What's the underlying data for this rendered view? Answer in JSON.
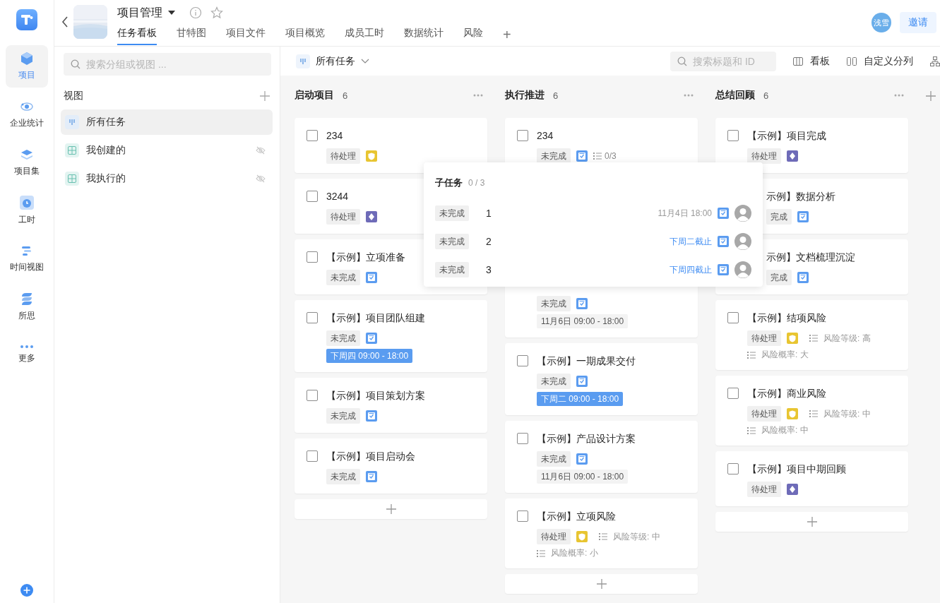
{
  "rail": {
    "items": [
      {
        "label": "项目",
        "selected": true
      },
      {
        "label": "企业统计",
        "selected": false
      },
      {
        "label": "项目集",
        "selected": false
      },
      {
        "label": "工时",
        "selected": false
      },
      {
        "label": "时间视图",
        "selected": false
      },
      {
        "label": "所思",
        "selected": false
      },
      {
        "label": "更多",
        "selected": false
      }
    ]
  },
  "header": {
    "title": "项目管理",
    "tabs": [
      {
        "label": "任务看板",
        "selected": true
      },
      {
        "label": "甘特图",
        "selected": false
      },
      {
        "label": "项目文件",
        "selected": false
      },
      {
        "label": "项目概览",
        "selected": false
      },
      {
        "label": "成员工时",
        "selected": false
      },
      {
        "label": "数据统计",
        "selected": false
      },
      {
        "label": "风险",
        "selected": false
      }
    ],
    "add_tab": "+",
    "avatar": "浅雪",
    "invite": "邀请"
  },
  "sidebar": {
    "search": {
      "placeholder": "搜索分组或视图 ..."
    },
    "section": "视图",
    "views": [
      {
        "label": "所有任务",
        "kind": "board",
        "selected": true,
        "hidden": false
      },
      {
        "label": "我创建的",
        "kind": "table",
        "selected": false,
        "hidden": true
      },
      {
        "label": "我执行的",
        "kind": "table",
        "selected": false,
        "hidden": true
      }
    ]
  },
  "toolbar": {
    "view": "所有任务",
    "search": {
      "placeholder": "搜索标题和 ID"
    },
    "actions": [
      "看板",
      "自定义分列"
    ]
  },
  "columns": [
    {
      "title": "启动项目",
      "count": "6",
      "cards": [
        {
          "kind": "normal",
          "title": "234",
          "checked": false,
          "status": "待处理",
          "badge": {
            "kind": "risk"
          }
        },
        {
          "kind": "normal",
          "title": "3244",
          "checked": false,
          "status": "待处理",
          "badge": {
            "kind": "milestone"
          }
        },
        {
          "kind": "normal",
          "title": "【示例】立项准备",
          "checked": false,
          "status": "未完成",
          "badge": {
            "kind": "task"
          }
        },
        {
          "kind": "normal",
          "title": "【示例】项目团队组建",
          "checked": false,
          "status": "未完成",
          "badge": {
            "kind": "task"
          },
          "date": {
            "text": "下周四 09:00 - 18:00",
            "highlight": true
          }
        },
        {
          "kind": "normal",
          "title": "【示例】项目策划方案",
          "checked": false,
          "status": "未完成",
          "badge": {
            "kind": "task"
          }
        },
        {
          "kind": "normal",
          "title": "【示例】项目启动会",
          "checked": false,
          "status": "未完成",
          "badge": {
            "kind": "task"
          }
        }
      ]
    },
    {
      "title": "执行推进",
      "count": "6",
      "cards": [
        {
          "kind": "normal",
          "title": "234",
          "checked": false,
          "status": "未完成",
          "badge": {
            "kind": "task"
          },
          "subtasks": "0/3"
        },
        {
          "kind": "untitled",
          "status": "未完成",
          "badge": {
            "kind": "task"
          },
          "date": {
            "text": "11月6日 09:00 - 18:00",
            "highlight": false
          }
        },
        {
          "kind": "normal",
          "title": "【示例】一期成果交付",
          "checked": false,
          "status": "未完成",
          "badge": {
            "kind": "task"
          },
          "date": {
            "text": "下周二 09:00 - 18:00",
            "highlight": true
          }
        },
        {
          "kind": "normal",
          "title": "【示例】产品设计方案",
          "checked": false,
          "status": "未完成",
          "badge": {
            "kind": "task"
          },
          "date": {
            "text": "11月6日 09:00 - 18:00",
            "highlight": false
          }
        },
        {
          "kind": "normal",
          "title": "【示例】立项风险",
          "checked": false,
          "status": "待处理",
          "badge": {
            "kind": "risk"
          },
          "risk": [
            "风险等级: 中",
            "风险概率: 小"
          ]
        }
      ]
    },
    {
      "title": "总结回顾",
      "count": "6",
      "cards": [
        {
          "kind": "normal",
          "title": "【示例】项目完成",
          "checked": false,
          "status": "待处理",
          "badge": {
            "kind": "milestone"
          }
        },
        {
          "kind": "covered",
          "title": "示例】数据分析",
          "status": "完成",
          "badge": {
            "kind": "task"
          }
        },
        {
          "kind": "covered",
          "title": "示例】文档梳理沉淀",
          "status": "完成",
          "badge": {
            "kind": "task"
          }
        },
        {
          "kind": "normal",
          "title": "【示例】结项风险",
          "checked": false,
          "status": "待处理",
          "badge": {
            "kind": "risk"
          },
          "risk": [
            "风险等级: 高",
            "风险概率: 大"
          ]
        },
        {
          "kind": "normal",
          "title": "【示例】商业风险",
          "checked": false,
          "status": "待处理",
          "badge": {
            "kind": "risk"
          },
          "risk": [
            "风险等级: 中",
            "风险概率: 中"
          ]
        },
        {
          "kind": "normal",
          "title": "【示例】项目中期回顾",
          "checked": false,
          "status": "待处理",
          "badge": {
            "kind": "milestone"
          }
        }
      ]
    }
  ],
  "popup": {
    "title": "子任务",
    "count": "0 / 3",
    "rows": [
      {
        "status": "未完成",
        "name": "1",
        "due": "11月4日 18:00",
        "highlight": false
      },
      {
        "status": "未完成",
        "name": "2",
        "due": "下周二截止",
        "highlight": true
      },
      {
        "status": "未完成",
        "name": "3",
        "due": "下周四截止",
        "highlight": true
      }
    ]
  }
}
